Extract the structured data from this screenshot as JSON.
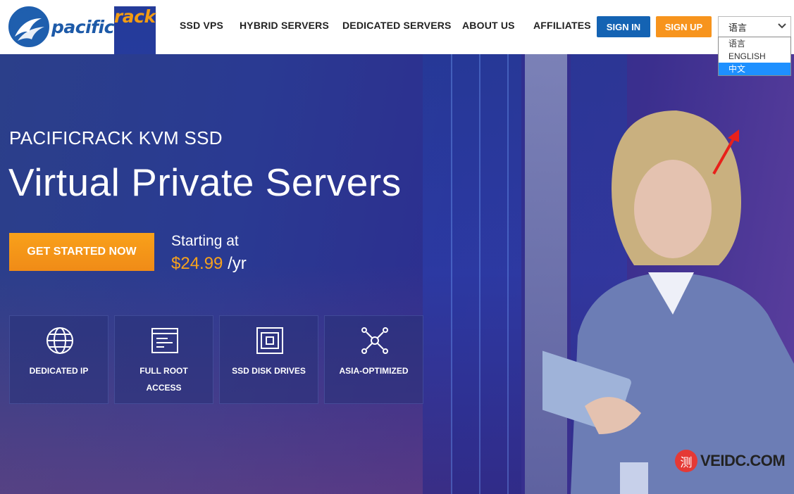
{
  "brand": {
    "part1": "pacific",
    "part2": "rack",
    "accent": "#f39c12",
    "primary": "#1d5aa8"
  },
  "nav": [
    {
      "label": "SSD VPS"
    },
    {
      "label": "HYBRID SERVERS"
    },
    {
      "label": "DEDICATED SERVERS"
    },
    {
      "label": "ABOUT US"
    },
    {
      "label": "AFFILIATES"
    }
  ],
  "header": {
    "sign_in": "SIGN IN",
    "sign_up": "SIGN UP"
  },
  "language": {
    "selected": "语言",
    "options": [
      "语言",
      "ENGLISH",
      "中文"
    ],
    "highlighted": "中文"
  },
  "hero": {
    "subtitle": "PACIFICRACK KVM SSD",
    "title": "Virtual Private Servers",
    "cta": "GET STARTED NOW",
    "starting_at": "Starting at",
    "price": "$24.99",
    "period": "/yr"
  },
  "features": [
    {
      "icon": "globe-icon",
      "label": "DEDICATED IP"
    },
    {
      "icon": "terminal-window-icon",
      "label": "FULL ROOT ACCESS"
    },
    {
      "icon": "disk-drive-icon",
      "label": "SSD DISK DRIVES"
    },
    {
      "icon": "network-nodes-icon",
      "label": "ASIA-OPTIMIZED"
    }
  ],
  "watermark": {
    "glyph": "测",
    "text": "VEIDC.COM"
  }
}
